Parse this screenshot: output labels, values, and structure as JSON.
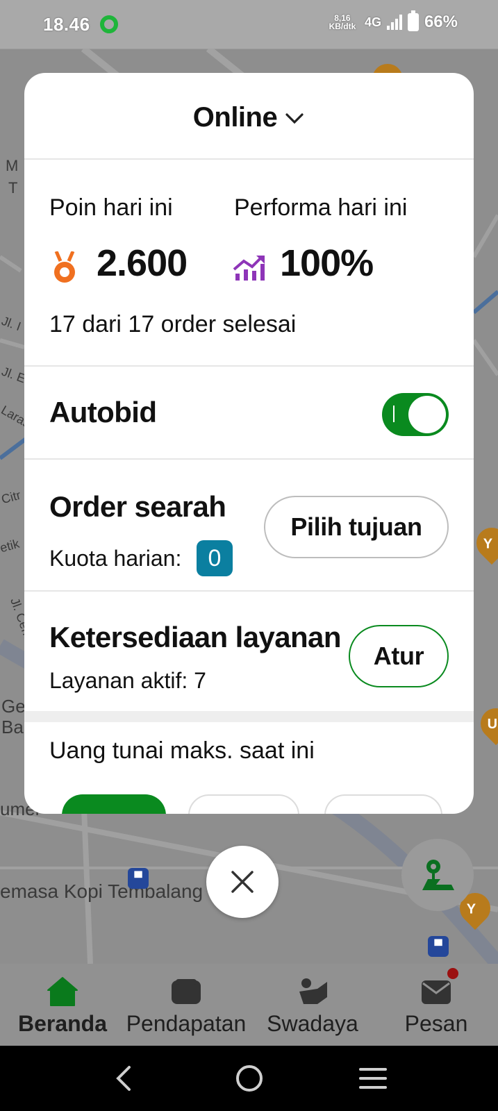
{
  "status_bar": {
    "time": "18.46",
    "speed_value": "8,16",
    "speed_unit": "KB/dtk",
    "network": "4G",
    "battery": "66%"
  },
  "map": {
    "labels": [
      "M",
      "T",
      "Jl. I",
      "Jl. E",
      "Laras",
      "Citr",
      "etik",
      "Jl. Cem",
      "Ge",
      "Ba",
      "umer",
      "emasa Kopi Tembalang"
    ]
  },
  "sheet": {
    "status_title": "Online",
    "points_label": "Poin hari ini",
    "points_value": "2.600",
    "performance_label": "Performa hari ini",
    "performance_value": "100%",
    "orders_summary": "17 dari 17 order selesai",
    "autobid_label": "Autobid",
    "autobid_on": true,
    "order_searah_title": "Order searah",
    "quota_label": "Kuota harian:",
    "quota_value": "0",
    "choose_destination_label": "Pilih tujuan",
    "availability_title": "Ketersediaan layanan",
    "active_services": "Layanan aktif: 7",
    "configure_label": "Atur",
    "max_cash_label": "Uang tunai maks. saat ini"
  },
  "bottom_nav": {
    "items": [
      {
        "label": "Beranda",
        "icon": "home-icon",
        "active": true
      },
      {
        "label": "Pendapatan",
        "icon": "wallet-icon",
        "active": false
      },
      {
        "label": "Swadaya",
        "icon": "community-icon",
        "active": false
      },
      {
        "label": "Pesan",
        "icon": "inbox-icon",
        "active": false,
        "has_notification": true
      }
    ]
  },
  "colors": {
    "brand_green": "#0a8a1f",
    "medal_orange": "#f07020",
    "performance_purple": "#8e35b8",
    "quota_badge": "#0b7fa0"
  }
}
